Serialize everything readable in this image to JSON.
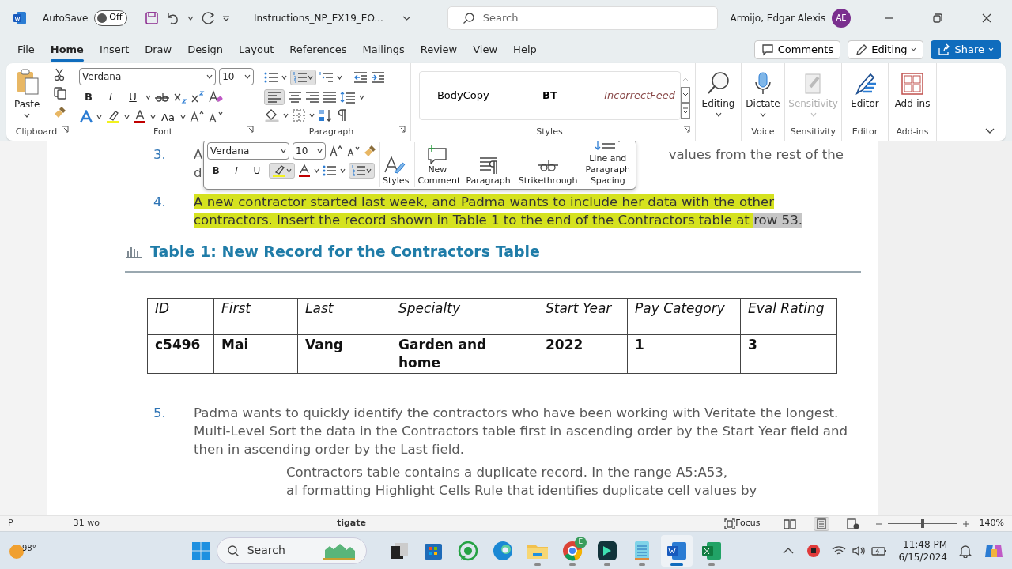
{
  "title_bar": {
    "autosave_label": "AutoSave",
    "autosave": {
      "on": false,
      "label": "Off"
    },
    "file_name": "Instructions_NP_EX19_EO...",
    "search": {
      "placeholder": "Search"
    },
    "user_name": "Armijo, Edgar Alexis",
    "user_initials": "AE"
  },
  "menu_tabs": [
    {
      "label": "File",
      "selected": false
    },
    {
      "label": "Home",
      "selected": true
    },
    {
      "label": "Insert",
      "selected": false
    },
    {
      "label": "Draw",
      "selected": false
    },
    {
      "label": "Design",
      "selected": false
    },
    {
      "label": "Layout",
      "selected": false
    },
    {
      "label": "References",
      "selected": false
    },
    {
      "label": "Mailings",
      "selected": false
    },
    {
      "label": "Review",
      "selected": false
    },
    {
      "label": "View",
      "selected": false
    },
    {
      "label": "Help",
      "selected": false
    }
  ],
  "header_buttons": [
    {
      "kind": "comments",
      "label": "Comments"
    },
    {
      "kind": "editing",
      "label": "Editing"
    },
    {
      "kind": "share",
      "label": "Share"
    }
  ],
  "ribbon": {
    "paste_label": "Paste",
    "font_name": "Verdana",
    "font_size": "10",
    "format_buttons": [
      "B",
      "I",
      "U"
    ],
    "change_case": "Aa",
    "styles": [
      "BodyCopy",
      "BT",
      "IncorrectFeed"
    ],
    "group_labels": [
      "Clipboard",
      "Font",
      "Paragraph",
      "Styles"
    ],
    "large_buttons": [
      {
        "kind": "editing",
        "label": "Editing",
        "disabled": false
      },
      {
        "kind": "dictate",
        "label": "Dictate",
        "disabled": false,
        "group": "Voice"
      },
      {
        "kind": "sensitivity",
        "label": "Sensitivity",
        "disabled": true,
        "group": "Sensitivity"
      },
      {
        "kind": "editor",
        "label": "Editor",
        "disabled": false,
        "group": "Editor"
      },
      {
        "kind": "addins",
        "label": "Add-ins",
        "disabled": false,
        "group": "Add-ins"
      }
    ]
  },
  "mini_toolbar": {
    "font_name": "Verdana",
    "font_size": "10",
    "format_buttons": [
      "B",
      "I",
      "U"
    ],
    "buttons": [
      {
        "kind": "styles",
        "label": "Styles"
      },
      {
        "kind": "comment",
        "label": "New Comment"
      },
      {
        "kind": "paragraph",
        "label": "Paragraph"
      },
      {
        "kind": "strikethrough",
        "label": "Strikethrough"
      },
      {
        "kind": "spacing",
        "label": "Line and Paragraph Spacing"
      }
    ]
  },
  "document": {
    "paragraphs": [
      {
        "kind": "obscured",
        "number": "3.",
        "fragments": [
          "A",
          "values from the rest of the",
          "d"
        ]
      },
      {
        "kind": "step",
        "number": "4.",
        "highlighted": true,
        "segments": [
          {
            "text": "A new contractor started last week, and Padma wants to include her data with the other contractors. Insert the record shown in Table 1 to the end of the Contractors table at ",
            "selected": false
          },
          {
            "text": "row 53.",
            "selected": true
          }
        ]
      },
      {
        "kind": "heading",
        "text": "Table 1: New Record for the Contractors Table"
      },
      {
        "kind": "table",
        "columns": [
          "ID",
          "First",
          "Last",
          "Specialty",
          "Start Year",
          "Pay Category",
          "Eval Rating"
        ],
        "rows": [
          [
            "c5496",
            "Mai",
            "Vang",
            "Garden and home",
            "2022",
            "1",
            "3"
          ]
        ]
      },
      {
        "kind": "step",
        "number": "5.",
        "highlighted": false,
        "segments": [
          {
            "text": "Padma wants to quickly identify the contractors who have been working with Veritate the longest. Multi-Level Sort the data in the Contractors table first in ascending order by the Start Year field and then in ascending order by the Last field.",
            "selected": false
          }
        ]
      },
      {
        "kind": "partial",
        "lines": [
          "Contractors table contains a duplicate record. In the range A5:A53,",
          "al formatting Highlight Cells Rule that identifies duplicate cell values by"
        ]
      }
    ]
  },
  "status_bar": {
    "fragments": [
      "P",
      "31 wo",
      "tigate"
    ],
    "focus_label": "Focus",
    "zoom": {
      "level": 0.5,
      "label": "140%"
    }
  },
  "taskbar": {
    "weather": "98°",
    "search": {
      "placeholder": "Search"
    },
    "apps": [
      {
        "kind": "taskview",
        "running": false,
        "active": false
      },
      {
        "kind": "store",
        "running": false,
        "active": false
      },
      {
        "kind": "whatsapp",
        "running": false,
        "active": false
      },
      {
        "kind": "edge",
        "running": false,
        "active": false
      },
      {
        "kind": "explorer",
        "running": true,
        "active": false
      },
      {
        "kind": "chrome",
        "running": true,
        "active": false,
        "badge": "E"
      },
      {
        "kind": "filmora",
        "running": true,
        "active": false
      },
      {
        "kind": "notepad",
        "running": true,
        "active": false
      },
      {
        "kind": "word",
        "running": true,
        "active": true
      },
      {
        "kind": "excel",
        "running": true,
        "active": false
      }
    ],
    "time": "11:48 PM",
    "date": "6/15/2024"
  }
}
